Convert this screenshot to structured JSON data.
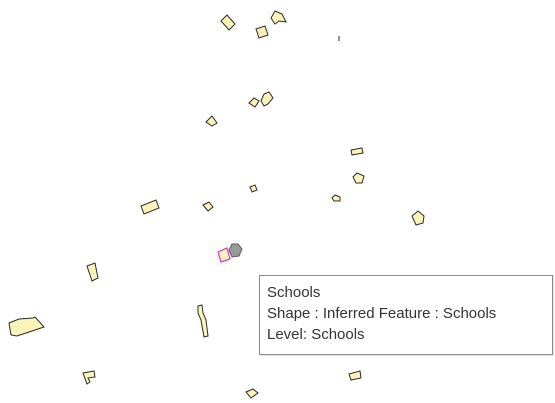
{
  "map": {
    "layer_name": "Schools",
    "feature_fill": "#fbf3b8",
    "feature_stroke": "#2b2b2b",
    "selected_stroke": "#e62ad6",
    "cursor_color": "#9a9a9a"
  },
  "tooltip": {
    "title": "Schools",
    "shape_line": "Shape : Inferred Feature : Schools",
    "level_line": "Level: Schools"
  }
}
